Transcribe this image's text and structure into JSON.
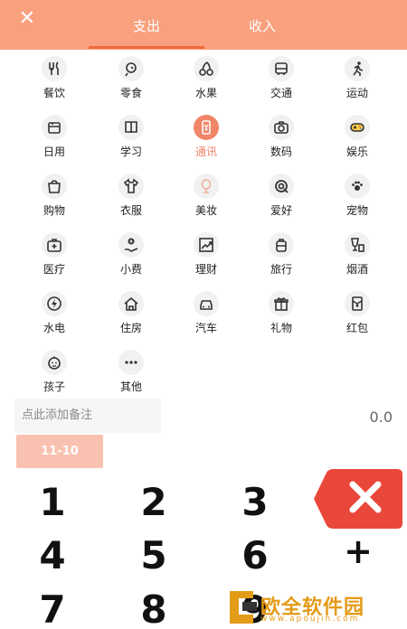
{
  "header": {
    "tabs": [
      "支出",
      "收入"
    ],
    "active_tab": "支出"
  },
  "categories": [
    {
      "label": "餐饮",
      "icon": "fork-knife-icon"
    },
    {
      "label": "零食",
      "icon": "lollipop-icon"
    },
    {
      "label": "水果",
      "icon": "cherry-icon"
    },
    {
      "label": "交通",
      "icon": "bus-icon"
    },
    {
      "label": "运动",
      "icon": "running-icon"
    },
    {
      "label": "日用",
      "icon": "calendar-icon"
    },
    {
      "label": "学习",
      "icon": "book-icon"
    },
    {
      "label": "通讯",
      "icon": "phone-icon",
      "active": true
    },
    {
      "label": "数码",
      "icon": "camera-icon"
    },
    {
      "label": "娱乐",
      "icon": "gamepad-icon"
    },
    {
      "label": "购物",
      "icon": "shopping-bag-icon"
    },
    {
      "label": "衣服",
      "icon": "tshirt-icon"
    },
    {
      "label": "美妆",
      "icon": "mirror-icon"
    },
    {
      "label": "爱好",
      "icon": "target-icon"
    },
    {
      "label": "宠物",
      "icon": "paw-icon"
    },
    {
      "label": "医疗",
      "icon": "medical-kit-icon"
    },
    {
      "label": "小费",
      "icon": "tip-icon"
    },
    {
      "label": "理财",
      "icon": "chart-up-icon"
    },
    {
      "label": "旅行",
      "icon": "suitcase-icon"
    },
    {
      "label": "烟酒",
      "icon": "drink-icon"
    },
    {
      "label": "水电",
      "icon": "lightning-icon"
    },
    {
      "label": "住房",
      "icon": "house-icon"
    },
    {
      "label": "汽车",
      "icon": "car-icon"
    },
    {
      "label": "礼物",
      "icon": "gift-icon"
    },
    {
      "label": "红包",
      "icon": "red-envelope-icon"
    },
    {
      "label": "孩子",
      "icon": "baby-face-icon"
    },
    {
      "label": "其他",
      "icon": "more-icon"
    }
  ],
  "note": {
    "placeholder": "点此添加备注",
    "amount": "0.0"
  },
  "date_button": "11-10",
  "keypad": {
    "keys": [
      "1",
      "2",
      "3",
      "4",
      "5",
      "6",
      "7",
      "8",
      "9"
    ],
    "plus": "+"
  },
  "watermark": {
    "text": "欧全软件园",
    "url": "www.apoujin.com"
  },
  "colors": {
    "header": "#f9a07e",
    "accent": "#f08568",
    "delete_button": "#e9473a",
    "date_button_bg": "#f9c2b0"
  }
}
